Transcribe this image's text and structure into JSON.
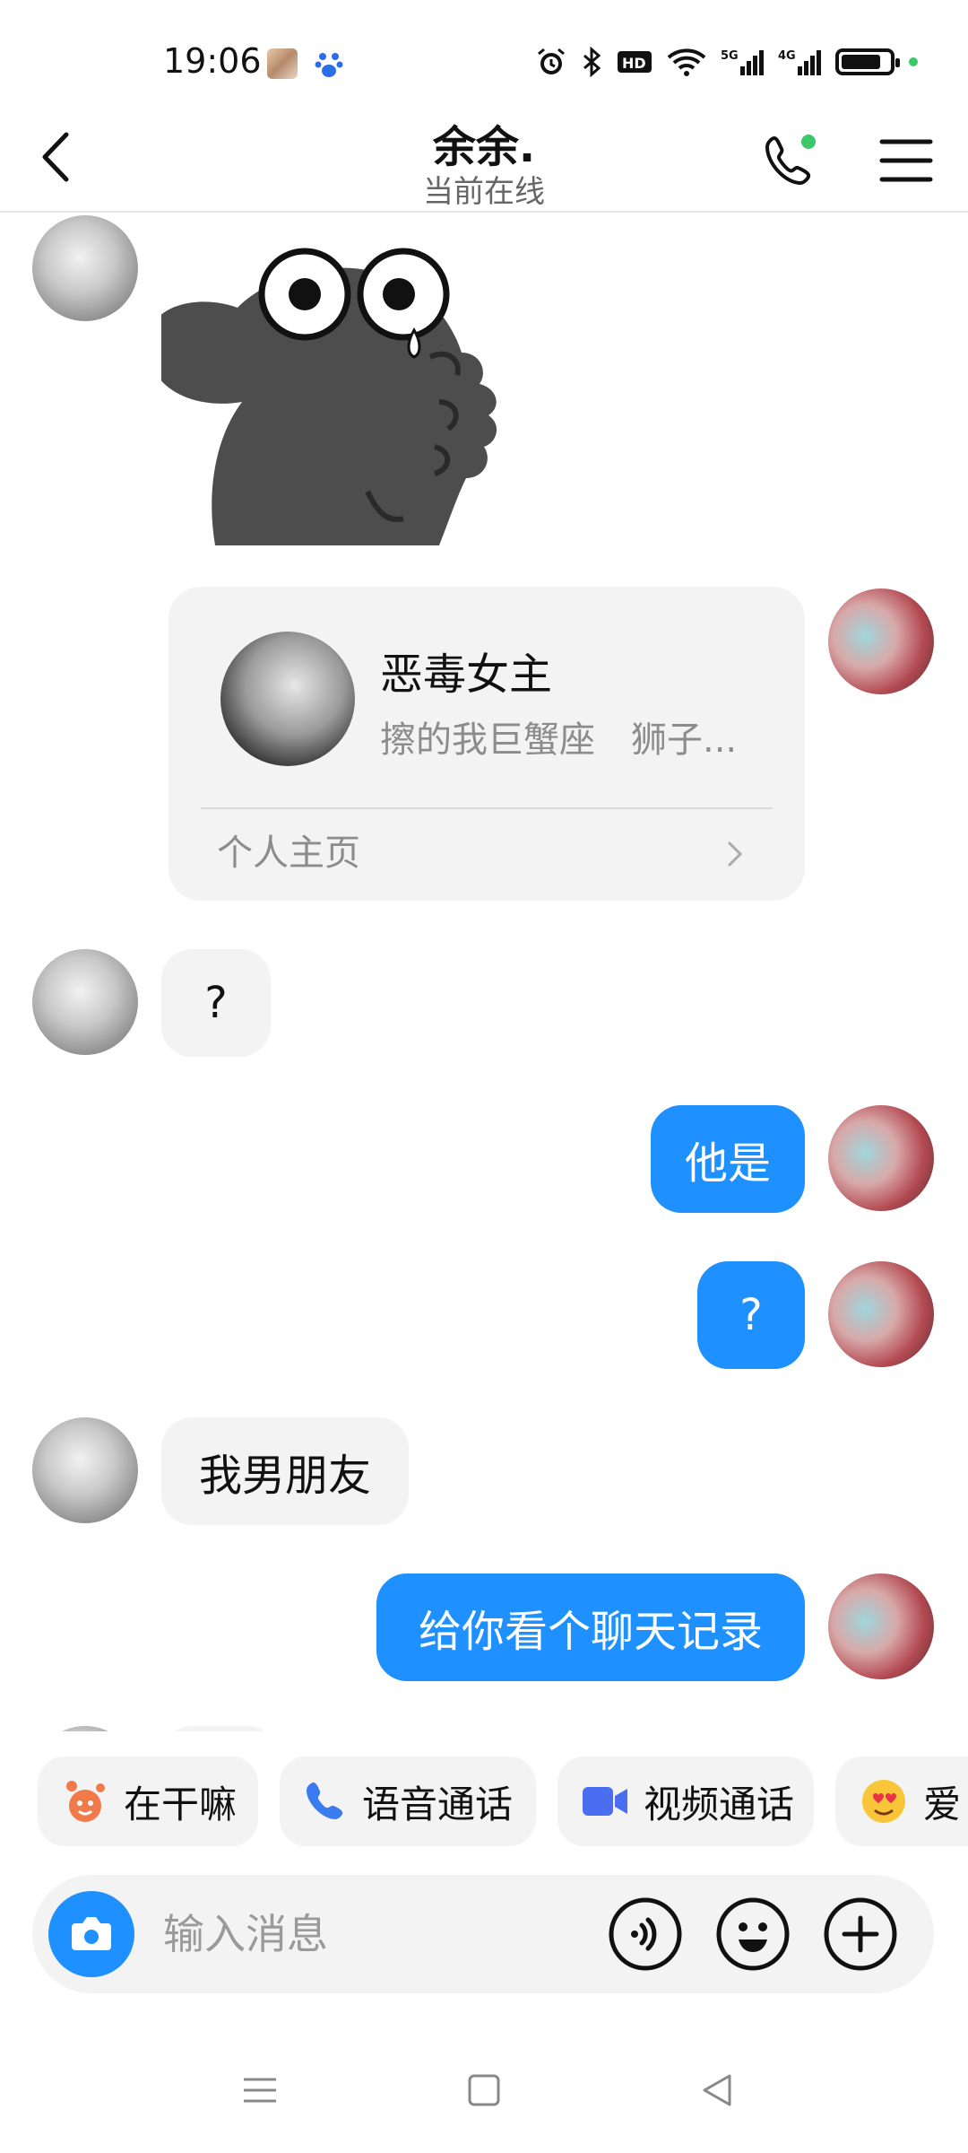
{
  "status_bar": {
    "time": "19:06",
    "network_5g": "5G",
    "network_4g": "4G",
    "hd_badge": "HD"
  },
  "header": {
    "title": "余余.",
    "subtitle": "当前在线"
  },
  "messages": [
    {
      "side": "in",
      "type": "sticker"
    },
    {
      "side": "out",
      "type": "profile_card",
      "name": "恶毒女主",
      "desc": "擦的我巨蟹座　狮子...",
      "link": "个人主页"
    },
    {
      "side": "in",
      "type": "text",
      "text": "?"
    },
    {
      "side": "out",
      "type": "text",
      "text": "他是"
    },
    {
      "side": "out",
      "type": "text",
      "text": "?"
    },
    {
      "side": "in",
      "type": "text",
      "text": "我男朋友"
    },
    {
      "side": "out",
      "type": "text",
      "text": "给你看个聊天记录"
    }
  ],
  "quick_actions": [
    {
      "label": "在干嘛",
      "icon": "emoji-wave-icon"
    },
    {
      "label": "语音通话",
      "icon": "phone-icon"
    },
    {
      "label": "视频通话",
      "icon": "video-icon"
    },
    {
      "label": "爱心",
      "icon": "heart-eyes-icon"
    }
  ],
  "input": {
    "placeholder": "输入消息"
  },
  "colors": {
    "accent": "#1e90ff",
    "bubble_in": "#f3f3f3",
    "online_dot": "#3cc86a"
  }
}
